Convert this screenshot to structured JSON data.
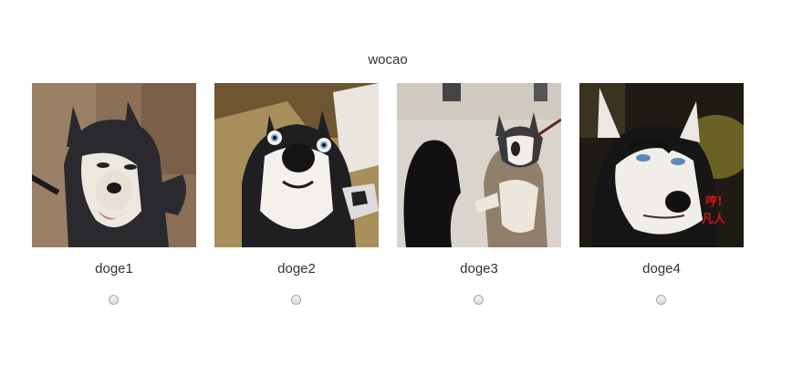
{
  "page": {
    "title": "wocao"
  },
  "options": [
    {
      "label": "doge1",
      "image": "husky-photo-1",
      "selected": false
    },
    {
      "label": "doge2",
      "image": "husky-photo-2",
      "selected": false
    },
    {
      "label": "doge3",
      "image": "husky-photo-3",
      "selected": false
    },
    {
      "label": "doge4",
      "image": "husky-photo-4",
      "selected": false,
      "image_text": [
        "哼!",
        "凡人"
      ]
    }
  ],
  "colors": {
    "text": "#333333",
    "background": "#ffffff",
    "stamp_text": "#d11313"
  }
}
